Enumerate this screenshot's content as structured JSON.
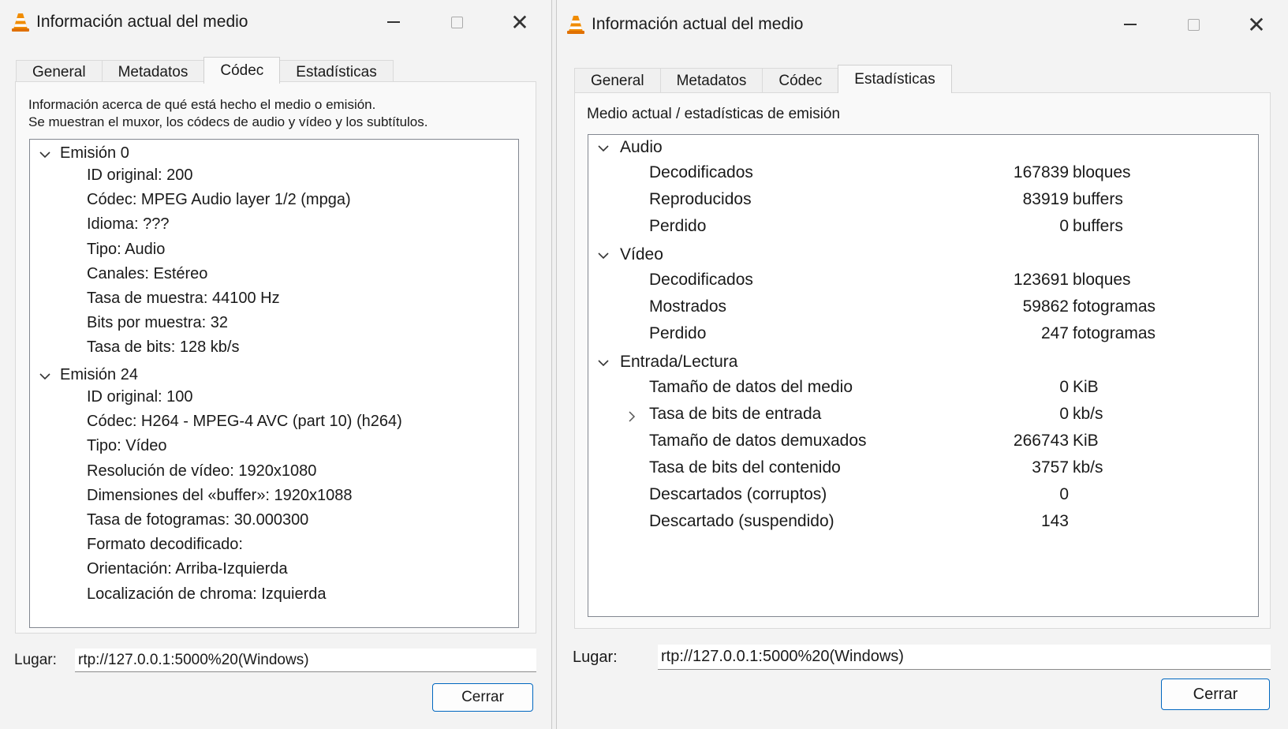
{
  "left_window": {
    "title": "Información actual del medio",
    "tabs": [
      {
        "label": "General"
      },
      {
        "label": "Metadatos"
      },
      {
        "label": "Códec"
      },
      {
        "label": "Estadísticas"
      }
    ],
    "active_tab": "Códec",
    "description_line1": "Información acerca de qué está hecho el medio o emisión.",
    "description_line2": "Se muestran el muxor, los códecs de audio y vídeo y los subtítulos.",
    "streams": [
      {
        "title": "Emisión 0",
        "items": [
          "ID original: 200",
          "Códec: MPEG Audio layer 1/2 (mpga)",
          "Idioma: ???",
          "Tipo: Audio",
          "Canales: Estéreo",
          "Tasa de muestra: 44100 Hz",
          "Bits por muestra: 32",
          "Tasa de bits: 128 kb/s"
        ]
      },
      {
        "title": "Emisión 24",
        "items": [
          "ID original: 100",
          "Códec: H264 - MPEG-4 AVC (part 10) (h264)",
          "Tipo: Vídeo",
          "Resolución de vídeo: 1920x1080",
          "Dimensiones del «buffer»: 1920x1088",
          "Tasa de fotogramas: 30.000300",
          "Formato decodificado:",
          "Orientación: Arriba-Izquierda",
          "Localización de chroma: Izquierda"
        ]
      }
    ],
    "location_label": "Lugar:",
    "location_value": "rtp://127.0.0.1:5000%20(Windows)",
    "close_label": "Cerrar"
  },
  "right_window": {
    "title": "Información actual del medio",
    "tabs": [
      {
        "label": "General"
      },
      {
        "label": "Metadatos"
      },
      {
        "label": "Códec"
      },
      {
        "label": "Estadísticas"
      }
    ],
    "active_tab": "Estadísticas",
    "description": "Medio actual / estadísticas de emisión",
    "sections": [
      {
        "title": "Audio",
        "rows": [
          {
            "name": "Decodificados",
            "value": "167839",
            "unit": "bloques"
          },
          {
            "name": "Reproducidos",
            "value": "83919",
            "unit": "buffers"
          },
          {
            "name": "Perdido",
            "value": "0",
            "unit": "buffers"
          }
        ]
      },
      {
        "title": "Vídeo",
        "rows": [
          {
            "name": "Decodificados",
            "value": "123691",
            "unit": "bloques"
          },
          {
            "name": "Mostrados",
            "value": "59862",
            "unit": "fotogramas"
          },
          {
            "name": "Perdido",
            "value": "247",
            "unit": "fotogramas"
          }
        ]
      },
      {
        "title": "Entrada/Lectura",
        "rows": [
          {
            "name": "Tamaño de datos del medio",
            "value": "0",
            "unit": "KiB"
          },
          {
            "name": "Tasa de bits de entrada",
            "value": "0",
            "unit": "kb/s",
            "expandable": true
          },
          {
            "name": "Tamaño de datos demuxados",
            "value": "266743",
            "unit": "KiB"
          },
          {
            "name": "Tasa de bits del contenido",
            "value": "3757",
            "unit": "kb/s"
          },
          {
            "name": "Descartados (corruptos)",
            "value": "0",
            "unit": ""
          },
          {
            "name": "Descartado (suspendido)",
            "value": "143",
            "unit": ""
          }
        ]
      }
    ],
    "location_label": "Lugar:",
    "location_value": "rtp://127.0.0.1:5000%20(Windows)",
    "close_label": "Cerrar"
  },
  "icons": {
    "app": "vlc-cone-icon",
    "minimize": "minimize-icon",
    "maximize": "maximize-icon",
    "close": "close-icon",
    "expanded": "chevron-down-icon",
    "collapsed": "chevron-right-icon"
  },
  "colors": {
    "accent_border": "#0067c0",
    "vlc_orange": "#f08c00"
  }
}
